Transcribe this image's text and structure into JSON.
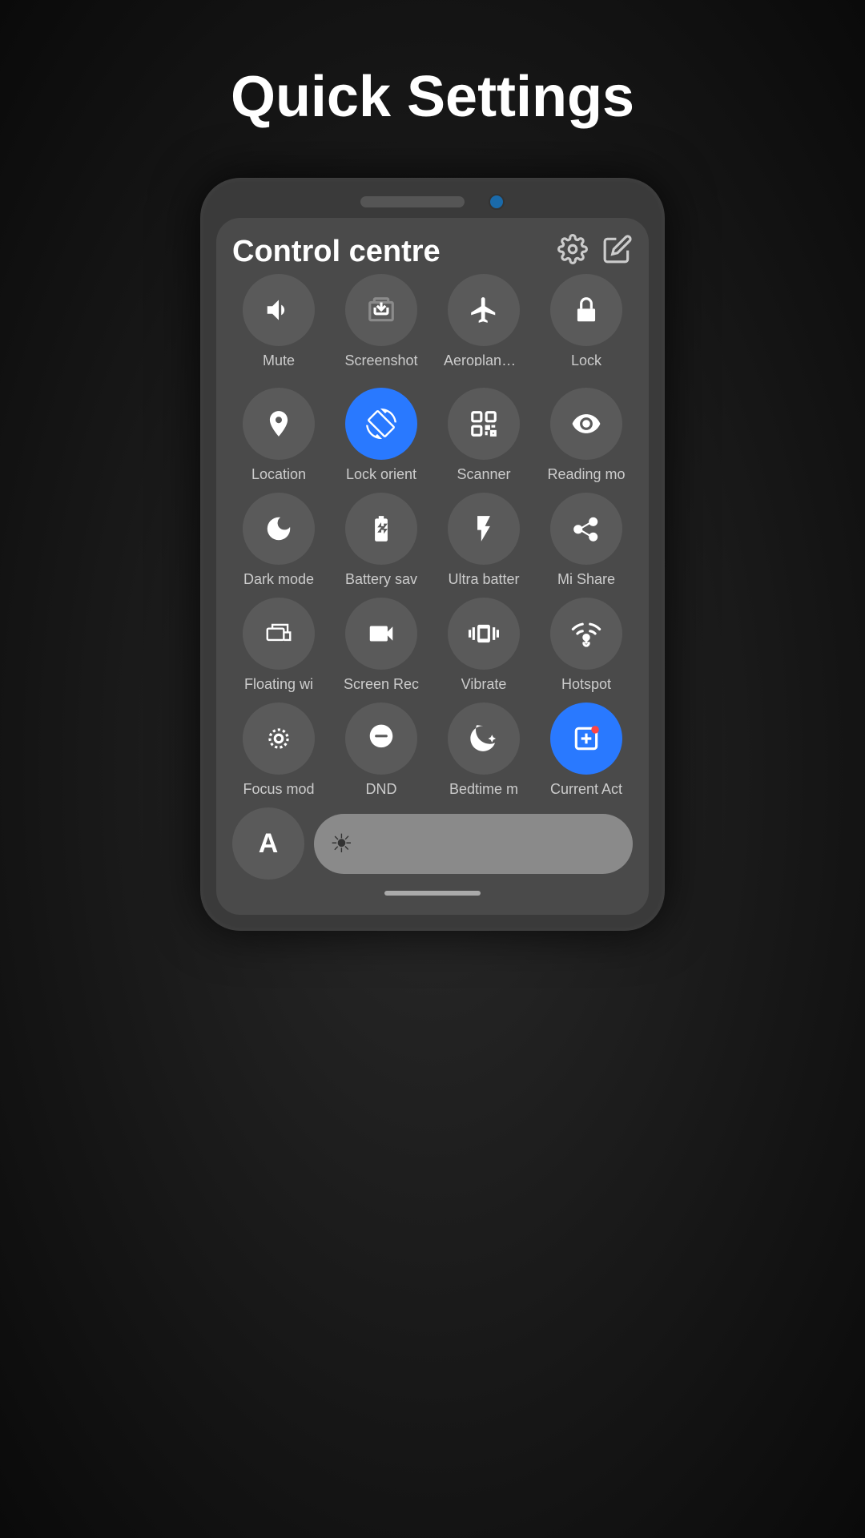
{
  "page": {
    "title": "Quick Settings"
  },
  "phone": {
    "screen_title": "Control centre"
  },
  "grid_rows": [
    [
      {
        "id": "mute",
        "label": "Mute",
        "active": false,
        "icon": "mute"
      },
      {
        "id": "screenshot",
        "label": "Screenshot",
        "active": false,
        "icon": "screenshot"
      },
      {
        "id": "aeroplane",
        "label": "Aeroplane m",
        "active": false,
        "icon": "aeroplane"
      },
      {
        "id": "lock",
        "label": "Lock",
        "active": false,
        "icon": "lock"
      }
    ],
    [
      {
        "id": "location",
        "label": "Location",
        "active": false,
        "icon": "location"
      },
      {
        "id": "lock-orient",
        "label": "Lock orient",
        "active": true,
        "icon": "lock-orient"
      },
      {
        "id": "scanner",
        "label": "Scanner",
        "active": false,
        "icon": "scanner"
      },
      {
        "id": "reading-mode",
        "label": "Reading mo",
        "active": false,
        "icon": "reading"
      }
    ],
    [
      {
        "id": "dark-mode",
        "label": "Dark mode",
        "active": false,
        "icon": "dark-mode"
      },
      {
        "id": "battery-sav",
        "label": "Battery sav",
        "active": false,
        "icon": "battery"
      },
      {
        "id": "ultra-batter",
        "label": "Ultra batter",
        "active": false,
        "icon": "ultra-battery"
      },
      {
        "id": "mi-share",
        "label": "Mi Share",
        "active": false,
        "icon": "mi-share"
      }
    ],
    [
      {
        "id": "floating-wi",
        "label": "Floating wi",
        "active": false,
        "icon": "floating"
      },
      {
        "id": "screen-rec",
        "label": "Screen Rec",
        "active": false,
        "icon": "screen-rec"
      },
      {
        "id": "vibrate",
        "label": "Vibrate",
        "active": false,
        "icon": "vibrate"
      },
      {
        "id": "hotspot",
        "label": "Hotspot",
        "active": false,
        "icon": "hotspot"
      }
    ],
    [
      {
        "id": "focus-mod",
        "label": "Focus mod",
        "active": false,
        "icon": "focus"
      },
      {
        "id": "dnd",
        "label": "DND",
        "active": false,
        "icon": "dnd"
      },
      {
        "id": "bedtime-m",
        "label": "Bedtime m",
        "active": false,
        "icon": "bedtime"
      },
      {
        "id": "current-act",
        "label": "Current Act",
        "active": true,
        "icon": "current-act"
      }
    ]
  ],
  "bottom": {
    "font_label": "A",
    "brightness_icon": "☀"
  }
}
